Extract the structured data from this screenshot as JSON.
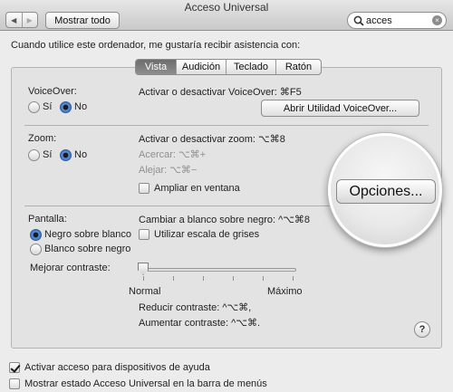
{
  "window": {
    "title": "Acceso Universal"
  },
  "toolbar": {
    "back_glyph": "◀",
    "forward_glyph": "▶",
    "show_all": "Mostrar todo",
    "search_value": "acces",
    "search_clear": "×"
  },
  "intro": "Cuando utilice este ordenador, me gustaría recibir asistencia con:",
  "tabs": [
    {
      "label": "Vista",
      "active": true
    },
    {
      "label": "Audición",
      "active": false
    },
    {
      "label": "Teclado",
      "active": false
    },
    {
      "label": "Ratón",
      "active": false
    }
  ],
  "voiceover": {
    "label": "VoiceOver:",
    "yes": "Sí",
    "no": "No",
    "selected": "No",
    "shortcut": "Activar o desactivar VoiceOver: ⌘F5",
    "utility_button": "Abrir Utilidad VoiceOver..."
  },
  "zoom": {
    "label": "Zoom:",
    "yes": "Sí",
    "no": "No",
    "selected": "No",
    "shortcut": "Activar o desactivar zoom: ⌥⌘8",
    "zoom_in": "Acercar: ⌥⌘+",
    "zoom_out": "Alejar: ⌥⌘−",
    "window_checkbox": "Ampliar en ventana",
    "window_checked": false,
    "options_button": "Opciones..."
  },
  "display": {
    "label": "Pantalla:",
    "black_on_white": "Negro sobre blanco",
    "white_on_black": "Blanco sobre negro",
    "selected": "Negro sobre blanco",
    "invert_shortcut": "Cambiar a blanco sobre negro: ^⌥⌘8",
    "grayscale": "Utilizar escala de grises",
    "grayscale_checked": false
  },
  "contrast": {
    "label": "Mejorar contraste:",
    "min_label": "Normal",
    "max_label": "Máximo",
    "level": 0,
    "reduce": "Reducir contraste: ^⌥⌘,",
    "increase": "Aumentar contraste: ^⌥⌘."
  },
  "help_glyph": "?",
  "footer": {
    "assistive_devices": "Activar acceso para dispositivos de ayuda",
    "assistive_checked": true,
    "menubar_status": "Mostrar estado Acceso Universal en la barra de menús",
    "menubar_checked": false
  },
  "colors": {
    "accent": "#2f66bb",
    "window_bg": "#ececec",
    "active_tab": "#7a7a7a"
  }
}
